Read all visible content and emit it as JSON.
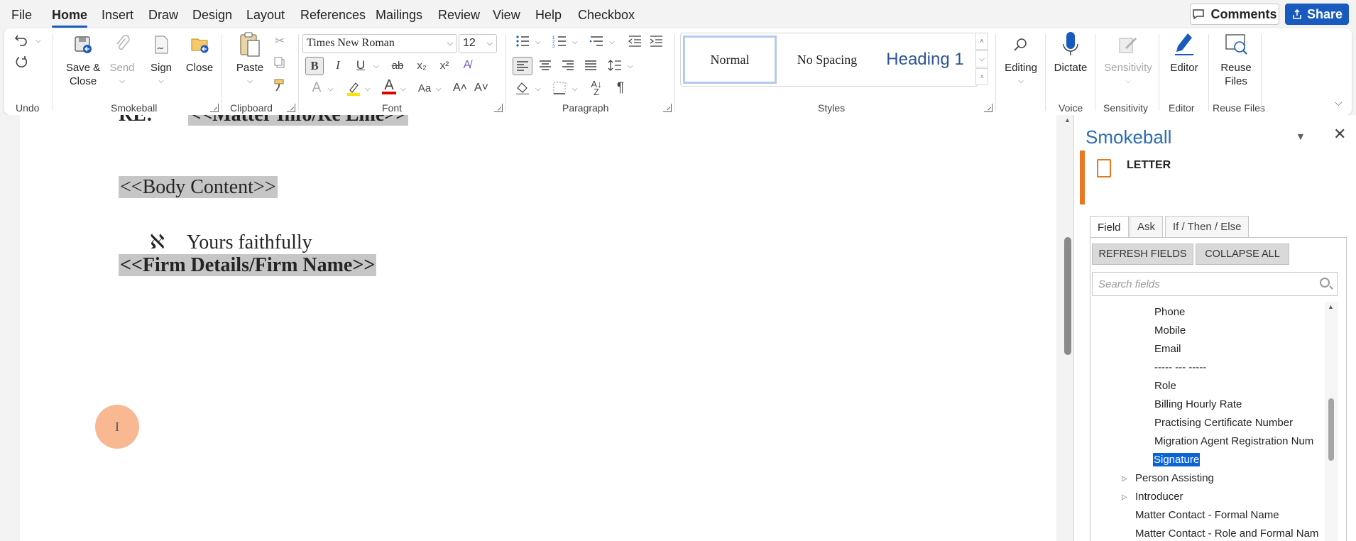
{
  "menu": {
    "tabs": [
      "File",
      "Home",
      "Insert",
      "Draw",
      "Design",
      "Layout",
      "References",
      "Mailings",
      "Review",
      "View",
      "Help",
      "Checkbox"
    ],
    "active": "Home",
    "comments_label": "Comments",
    "share_label": "Share"
  },
  "ribbon": {
    "undo_group": "Undo",
    "smokeball": {
      "label": "Smokeball",
      "save_close": "Save &",
      "save_close2": "Close",
      "send": "Send",
      "sign": "Sign",
      "close": "Close"
    },
    "clipboard": {
      "label": "Clipboard",
      "paste": "Paste"
    },
    "font": {
      "label": "Font",
      "name": "Times New Roman",
      "size": "12"
    },
    "paragraph": {
      "label": "Paragraph"
    },
    "styles": {
      "label": "Styles",
      "normal": "Normal",
      "no_spacing": "No Spacing",
      "heading1": "Heading 1"
    },
    "editing": "Editing",
    "voice": {
      "label": "Voice",
      "dictate": "Dictate"
    },
    "sensitivity": {
      "label": "Sensitivity",
      "button": "Sensitivity"
    },
    "editor": {
      "label": "Editor",
      "button": "Editor"
    },
    "reuse": {
      "label": "Reuse Files",
      "button": "Reuse",
      "button2": "Files"
    }
  },
  "document": {
    "re_line": "RE:",
    "matter_field": "<<Matter Info/Re Line>>",
    "body_field": "<<Body Content>>",
    "bullet": "ℵ",
    "closing": "Yours faithfully",
    "firm_field": "<<Firm Details/Firm Name>>"
  },
  "pane": {
    "title": "Smokeball",
    "letter": "LETTER",
    "tabs": [
      "Field",
      "Ask",
      "If / Then / Else"
    ],
    "refresh": "REFRESH FIELDS",
    "collapse": "COLLAPSE ALL",
    "search_placeholder": "Search fields",
    "tree": [
      "Phone",
      "Mobile",
      "Email",
      "----- --- -----",
      "Role",
      "Billing Hourly Rate",
      "Practising Certificate Number",
      "Migration Agent Registration Num",
      "Signature",
      "Person Assisting",
      "Introducer",
      "Matter Contact - Formal Name",
      "Matter Contact - Role and Formal Nam"
    ],
    "selected": "Signature"
  },
  "colors": {
    "accent": "#185abd",
    "smokeball_orange": "#e87722",
    "selection": "#0a64d6"
  }
}
